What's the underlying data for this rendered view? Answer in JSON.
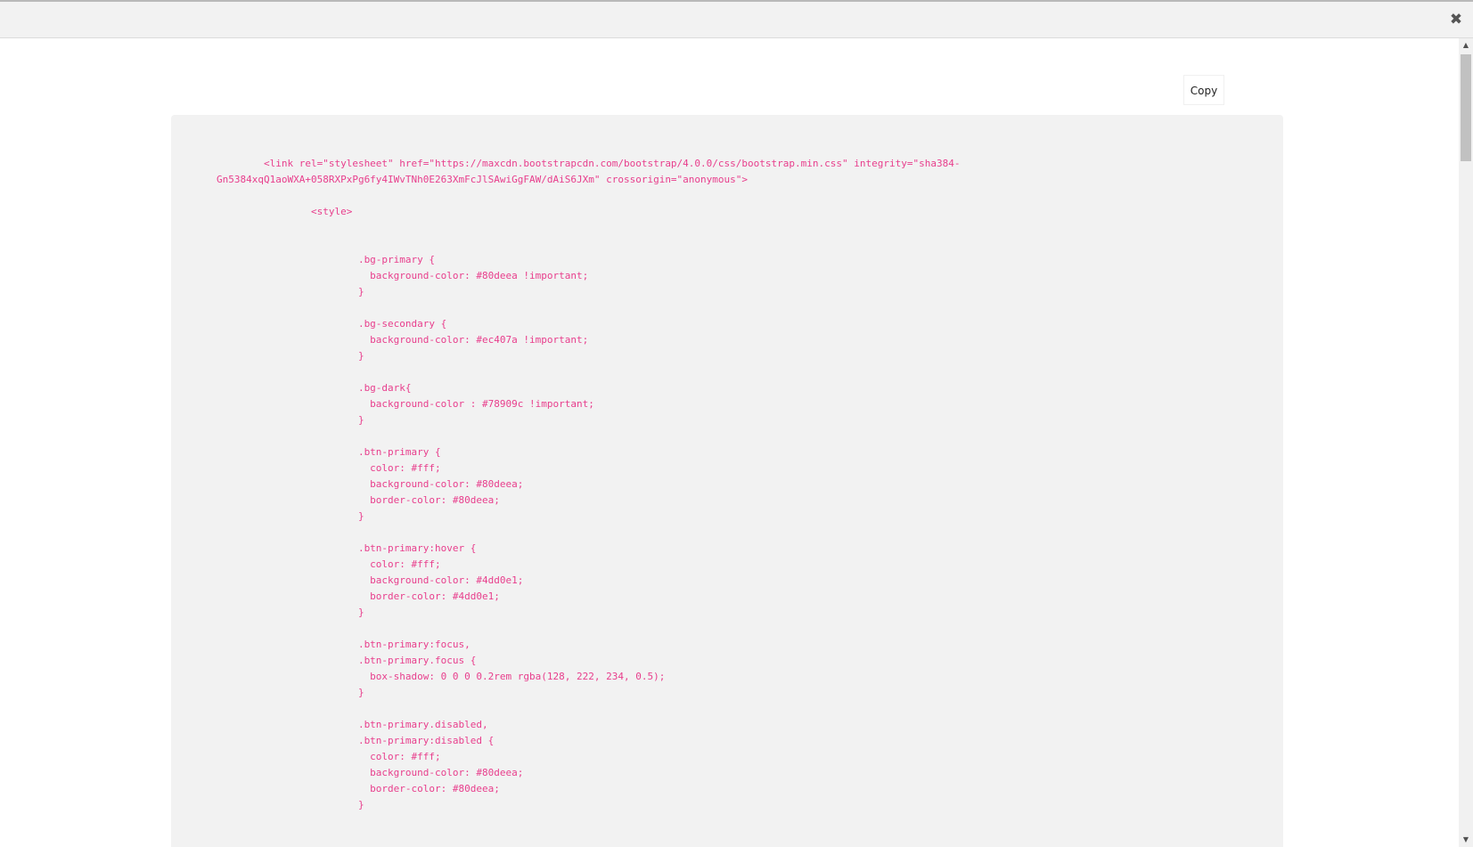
{
  "toolbar": {
    "close_icon": "close-icon",
    "close_glyph": "✖"
  },
  "content": {
    "copy_label": "Copy",
    "code_lines": [
      "        <link rel=\"stylesheet\" href=\"https://maxcdn.bootstrapcdn.com/bootstrap/4.0.0/css/bootstrap.min.css\" integrity=\"sha384-",
      "Gn5384xqQ1aoWXA+058RXPxPg6fy4IWvTNh0E263XmFcJlSAwiGgFAW/dAiS6JXm\" crossorigin=\"anonymous\">",
      "",
      "                <style>",
      "",
      "",
      "                        .bg-primary {",
      "                          background-color: #80deea !important;",
      "                        }",
      "",
      "                        .bg-secondary {",
      "                          background-color: #ec407a !important;",
      "                        }",
      "",
      "                        .bg-dark{",
      "                          background-color : #78909c !important;",
      "                        }",
      "",
      "                        .btn-primary {",
      "                          color: #fff;",
      "                          background-color: #80deea;",
      "                          border-color: #80deea;",
      "                        }",
      "",
      "                        .btn-primary:hover {",
      "                          color: #fff;",
      "                          background-color: #4dd0e1;",
      "                          border-color: #4dd0e1;",
      "                        }",
      "",
      "                        .btn-primary:focus,",
      "                        .btn-primary.focus {",
      "                          box-shadow: 0 0 0 0.2rem rgba(128, 222, 234, 0.5);",
      "                        }",
      "",
      "                        .btn-primary.disabled,",
      "                        .btn-primary:disabled {",
      "                          color: #fff;",
      "                          background-color: #80deea;",
      "                          border-color: #80deea;",
      "                        }"
    ]
  },
  "colors": {
    "code_text": "#e83e8c",
    "panel_bg": "#f2f2f2",
    "topbar_bg": "#f2f2f2"
  },
  "scrollbar": {
    "up_glyph": "▲",
    "down_glyph": "▼"
  }
}
